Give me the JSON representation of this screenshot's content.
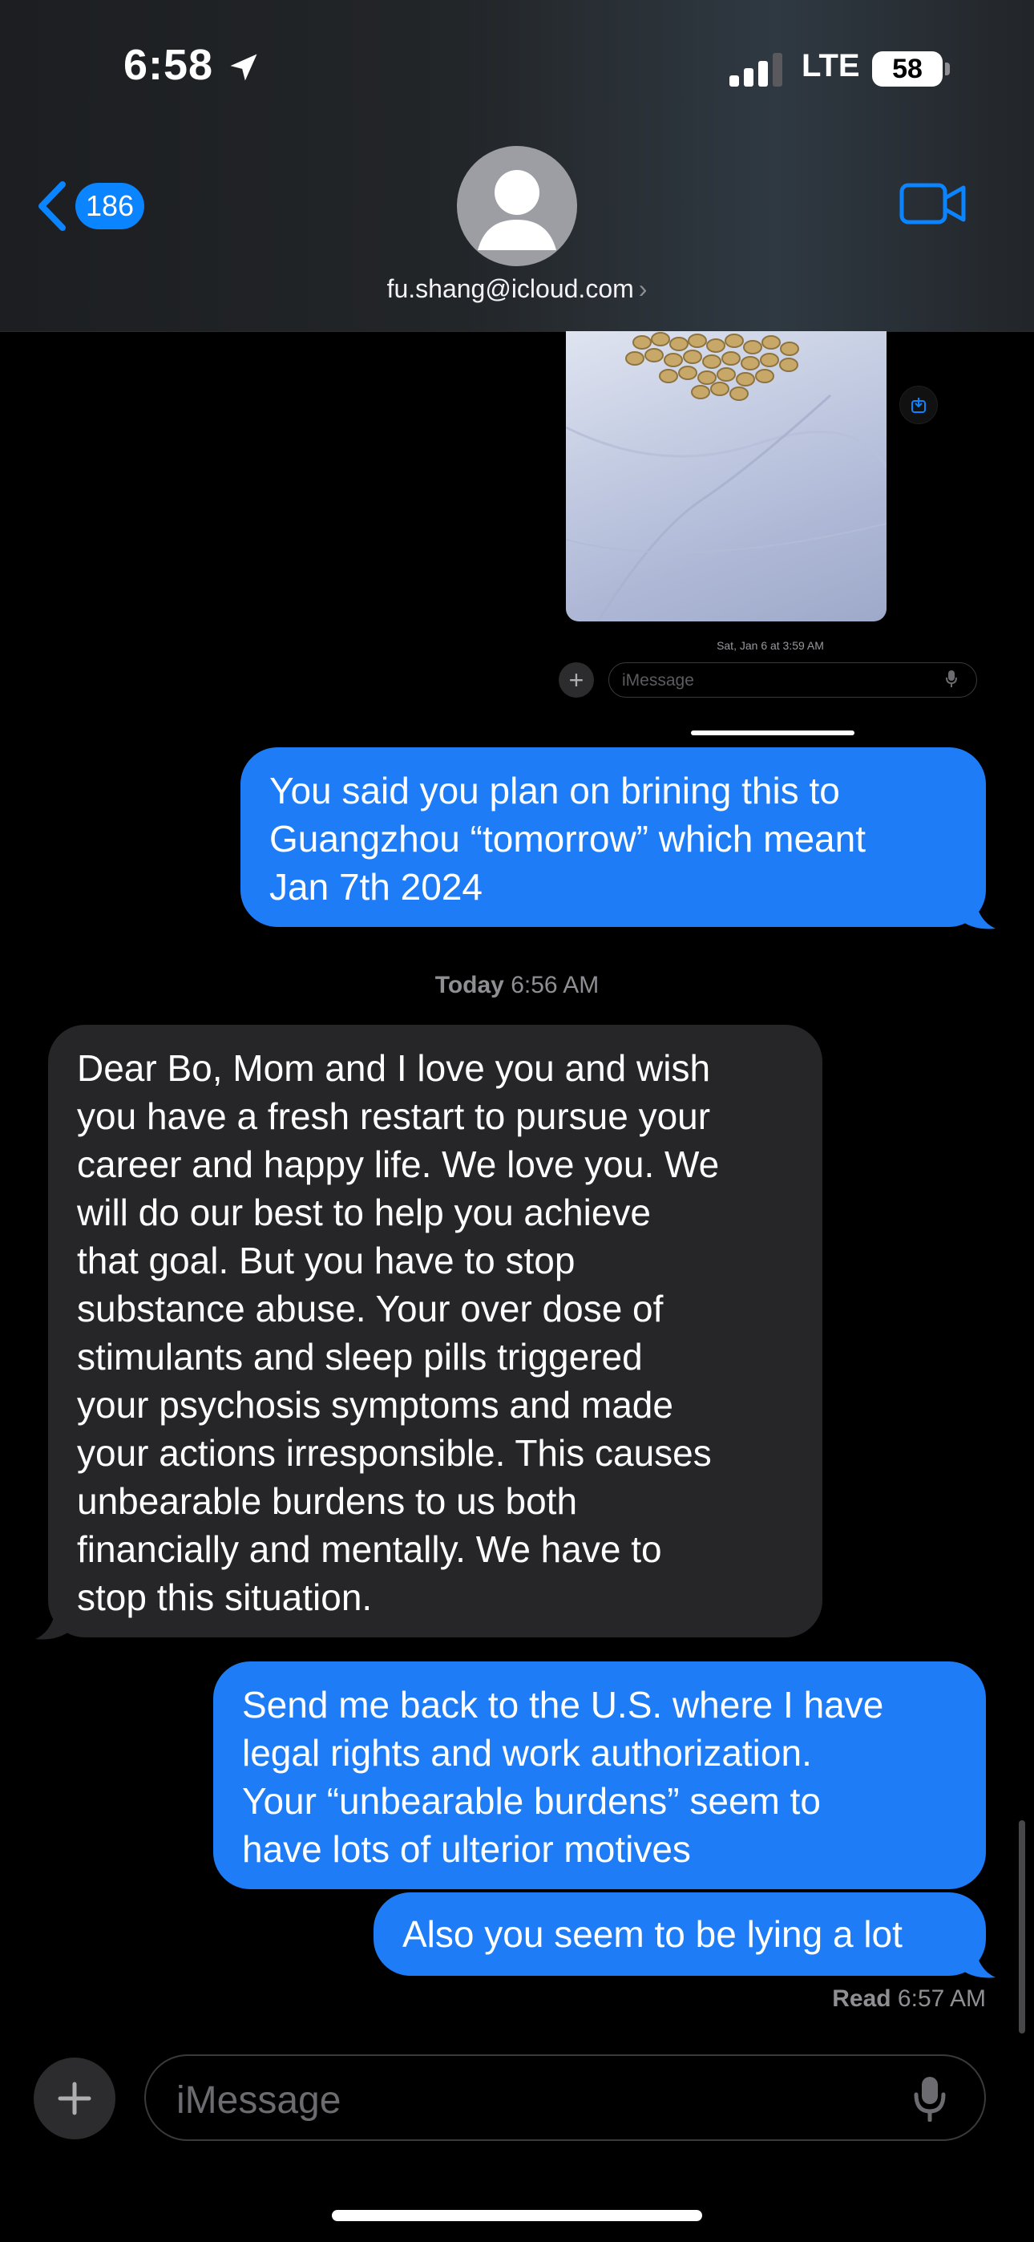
{
  "status_bar": {
    "time": "6:58",
    "network": "LTE",
    "battery": "58"
  },
  "header": {
    "back_count": "186",
    "contact": "fu.shang@icloud.com",
    "contact_chevron": "›"
  },
  "embedded_screenshot": {
    "timestamp": "Sat, Jan 6 at 3:59 AM",
    "input_placeholder": "iMessage",
    "plus": "+"
  },
  "messages": [
    {
      "from": "me",
      "lines": [
        "You said you plan on brining this to",
        "Guangzhou “tomorrow” which meant",
        "Jan 7th 2024"
      ]
    },
    {
      "from": "them",
      "lines": [
        "Dear Bo, Mom and I love you and wish",
        "you have a fresh restart to pursue your",
        "career and happy life. We love you. We",
        "will do our best to help you achieve",
        "that goal. But you have to stop",
        "substance abuse. Your over dose of",
        "stimulants and sleep pills triggered",
        "your psychosis symptoms and made",
        "your actions irresponsible. This causes",
        "unbearable burdens to us both",
        "financially and mentally. We have to",
        "stop this situation."
      ]
    },
    {
      "from": "me",
      "lines": [
        "Send me back to the U.S. where I have",
        "legal rights and work authorization.",
        "Your “unbearable burdens” seem to",
        "have lots of ulterior motives"
      ]
    },
    {
      "from": "me",
      "lines": [
        "Also you seem to be lying a lot"
      ]
    }
  ],
  "timestamp": {
    "day": "Today",
    "time": "6:56 AM"
  },
  "read_receipt": {
    "label": "Read",
    "time": "6:57 AM"
  },
  "composer": {
    "placeholder": "iMessage"
  },
  "colors": {
    "outgoing_bubble": "#1e7cf7",
    "incoming_bubble": "#262629",
    "accent": "#0a84ff",
    "background": "#000000"
  },
  "icons": [
    "location-arrow-icon",
    "signal-icon",
    "battery-icon",
    "back-chevron-icon",
    "avatar-person-icon",
    "video-camera-icon",
    "plus-icon",
    "microphone-icon",
    "share-icon"
  ]
}
